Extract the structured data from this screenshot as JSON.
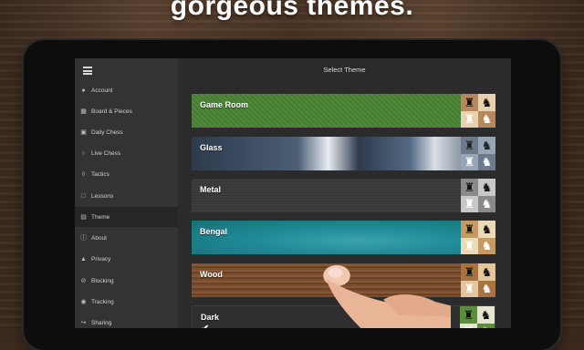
{
  "headline": "gorgeous themes.",
  "sidebar": {
    "items": [
      {
        "label": "Account",
        "icon": "person-icon",
        "glyph": "●"
      },
      {
        "label": "Board & Pieces",
        "icon": "board-icon",
        "glyph": "▦"
      },
      {
        "label": "Daily Chess",
        "icon": "calendar-icon",
        "glyph": "▣"
      },
      {
        "label": "Live Chess",
        "icon": "clock-icon",
        "glyph": "○"
      },
      {
        "label": "Tactics",
        "icon": "lightbulb-icon",
        "glyph": "◊"
      },
      {
        "label": "Lessons",
        "icon": "lessons-icon",
        "glyph": "□"
      },
      {
        "label": "Theme",
        "icon": "theme-icon",
        "glyph": "▤",
        "active": true
      },
      {
        "label": "About",
        "icon": "info-icon",
        "glyph": "ⓘ"
      },
      {
        "label": "Privacy",
        "icon": "lock-icon",
        "glyph": "▲"
      },
      {
        "label": "Blocking",
        "icon": "block-icon",
        "glyph": "⊘"
      },
      {
        "label": "Tracking",
        "icon": "people-icon",
        "glyph": "◉"
      },
      {
        "label": "Sharing",
        "icon": "share-icon",
        "glyph": "↪"
      }
    ]
  },
  "main": {
    "title": "Select Theme",
    "themes": [
      {
        "label": "Game Room",
        "selected": false
      },
      {
        "label": "Glass",
        "selected": false
      },
      {
        "label": "Metal",
        "selected": false
      },
      {
        "label": "Bengal",
        "selected": false
      },
      {
        "label": "Wood",
        "selected": false
      },
      {
        "label": "Dark",
        "selected": true,
        "check": "✔"
      }
    ]
  },
  "colors": {
    "game_room": "#4e8a3a",
    "glass": "#3b4a5c",
    "metal": "#3a3a3a",
    "bengal": "#1f8a96",
    "wood": "#7a4e2d",
    "dark": "#2f2f2f"
  }
}
